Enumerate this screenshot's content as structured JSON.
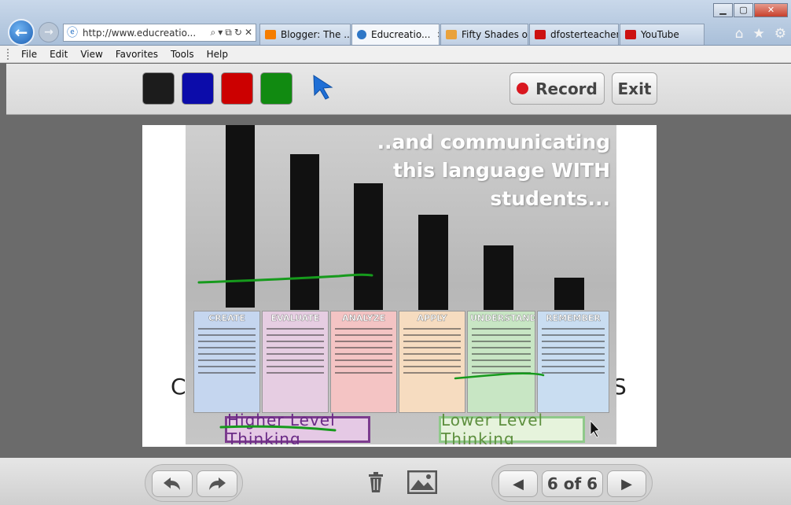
{
  "browser": {
    "url": "http://www.educreatio...",
    "tabs": [
      {
        "label": "Blogger: The ...",
        "color": "#f57d00"
      },
      {
        "label": "Educreatio...",
        "color": "#2f77c7"
      },
      {
        "label": "Fifty Shades of...",
        "color": "#e9a23b"
      },
      {
        "label": "dfosterteacher...",
        "color": "#cc1111"
      },
      {
        "label": "YouTube",
        "color": "#cc1111"
      }
    ],
    "menu": [
      "File",
      "Edit",
      "View",
      "Favorites",
      "Tools",
      "Help"
    ]
  },
  "toolbar": {
    "colors": [
      "#1c1c1c",
      "#0c0caa",
      "#cc0000",
      "#118a11"
    ],
    "record_label": "Record",
    "exit_label": "Exit"
  },
  "slide": {
    "caption_lines": [
      "..and communicating",
      "this language WITH",
      "students..."
    ],
    "posters": [
      {
        "title": "CREATE",
        "color": "#c5d6ef"
      },
      {
        "title": "EVALUATE",
        "color": "#e6cde2"
      },
      {
        "title": "ANALYZE",
        "color": "#f4c4c4"
      },
      {
        "title": "APPLY",
        "color": "#f6dcc0"
      },
      {
        "title": "UNDERSTAND",
        "color": "#c8e6c4"
      },
      {
        "title": "REMEMBER",
        "color": "#c9ddf1"
      }
    ],
    "banner_left": "Higher Level Thinking",
    "banner_right": "Lower Level Thinking",
    "left_letter": "C",
    "right_letter": "S"
  },
  "pager": {
    "label": "6 of 6"
  }
}
